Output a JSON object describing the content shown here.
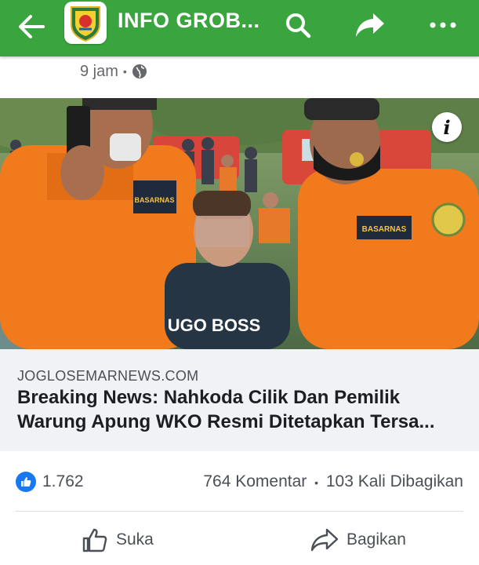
{
  "header": {
    "title": "INFO GROB...",
    "back_icon": "arrow-left-icon",
    "search_icon": "search-icon",
    "share_icon": "share-arrow-icon",
    "more_icon": "more-horizontal-icon",
    "bar_color": "#3aa53f"
  },
  "post": {
    "time": "9 jam",
    "separator": "•",
    "privacy_icon": "globe-icon"
  },
  "link_preview": {
    "image_text": "UGO BOSS",
    "uniform_badge_left": "BASARNAS",
    "uniform_badge_right": "BASARNAS",
    "domain": "JOGLOSEMARNEWS.COM",
    "headline_line1": "Breaking News: Nahkoda Cilik Dan Pemilik",
    "headline_line2": "Warung Apung WKO Resmi Ditetapkan Tersa..."
  },
  "stats": {
    "like_count": "1.762",
    "comments": "764 Komentar",
    "separator": "•",
    "shares": "103 Kali Dibagikan"
  },
  "actions": {
    "like_label": "Suka",
    "share_label": "Bagikan"
  },
  "colors": {
    "like_blue": "#1877f2",
    "rescue_orange": "#f07a1c"
  }
}
